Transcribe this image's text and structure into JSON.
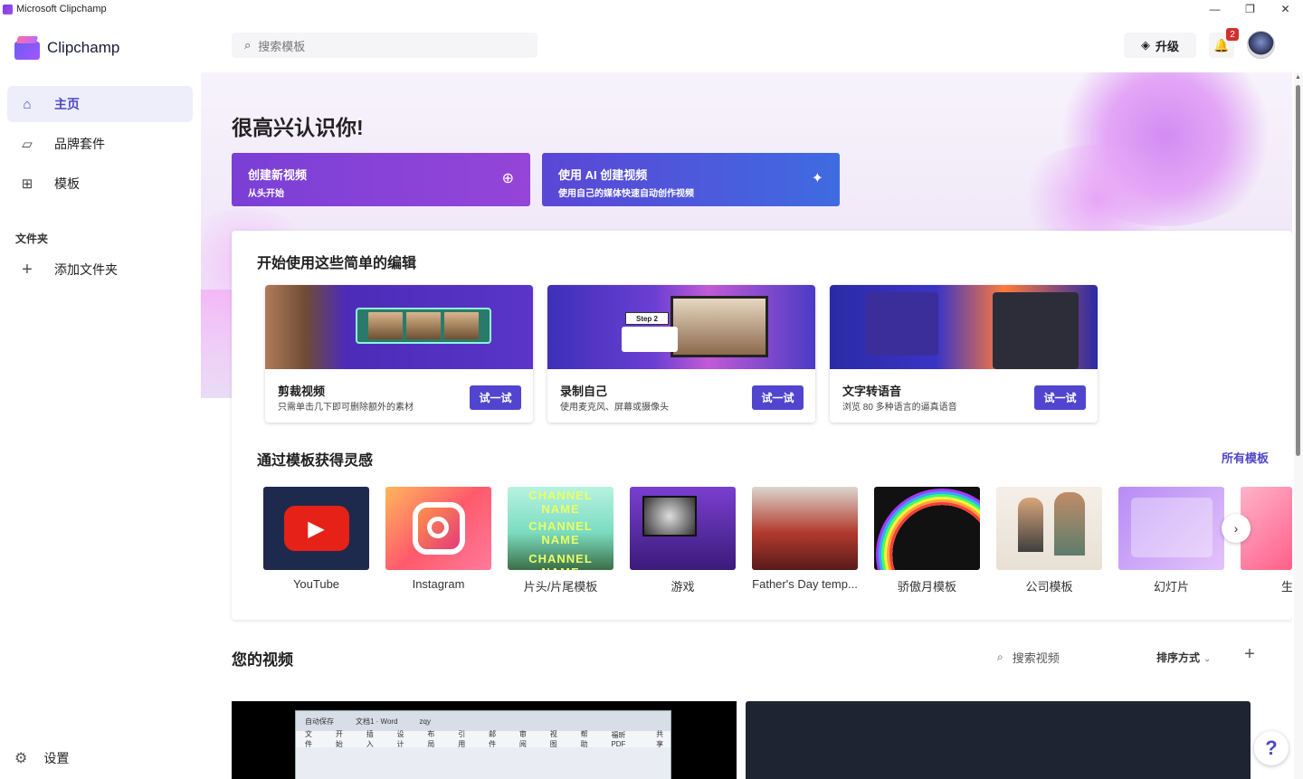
{
  "window": {
    "title": "Microsoft Clipchamp",
    "controls": {
      "minimize": "—",
      "maximize": "❐",
      "close": "✕"
    }
  },
  "sidebar": {
    "brand": "Clipchamp",
    "items": [
      {
        "label": "主页",
        "icon": "home-icon",
        "glyph": "⌂",
        "active": true
      },
      {
        "label": "品牌套件",
        "icon": "brand-kit-icon",
        "glyph": "▱",
        "active": false
      },
      {
        "label": "模板",
        "icon": "templates-icon",
        "glyph": "⊞",
        "active": false
      }
    ],
    "section_label": "文件夹",
    "add_folder": {
      "label": "添加文件夹",
      "glyph": "+"
    },
    "settings": {
      "label": "设置",
      "glyph": "⚙"
    }
  },
  "topbar": {
    "search_placeholder": "搜索模板",
    "search_glyph": "⌕",
    "upgrade_label": "升级",
    "upgrade_glyph": "◈",
    "bell_glyph": "🔔",
    "notification_count": "2"
  },
  "hero": {
    "greeting": "很高兴认识你!",
    "create": {
      "title": "创建新视频",
      "subtitle": "从头开始",
      "glyph": "⊕"
    },
    "ai": {
      "title": "使用 AI 创建视频",
      "subtitle": "使用自己的媒体快速自动创作视频",
      "glyph": "✦"
    }
  },
  "quick_edits": {
    "heading": "开始使用这些简单的编辑",
    "cards": [
      {
        "title": "剪裁视频",
        "subtitle": "只需单击几下即可删除额外的素材",
        "button": "试一试"
      },
      {
        "title": "录制自己",
        "subtitle": "使用麦克风、屏幕或摄像头",
        "button": "试一试",
        "badge": "Step 2"
      },
      {
        "title": "文字转语音",
        "subtitle": "浏览 80 多种语言的逼真语音",
        "button": "试一试"
      }
    ]
  },
  "templates": {
    "heading": "通过模板获得灵感",
    "all_link": "所有模板",
    "items": [
      {
        "name": "YouTube"
      },
      {
        "name": "Instagram"
      },
      {
        "name": "片头/片尾模板",
        "thumb_text": "CHANNEL NAME"
      },
      {
        "name": "游戏"
      },
      {
        "name": "Father's Day temp..."
      },
      {
        "name": "骄傲月模板"
      },
      {
        "name": "公司模板"
      },
      {
        "name": "幻灯片"
      },
      {
        "name": "生"
      }
    ],
    "next_glyph": "›"
  },
  "videos": {
    "heading": "您的视频",
    "search_placeholder": "搜索视频",
    "search_glyph": "⌕",
    "sort_label": "排序方式",
    "sort_glyph": "⌄",
    "add_glyph": "+",
    "word_preview": {
      "titlebar": [
        "自动保存",
        "文档1 · Word",
        "zqy"
      ],
      "menu": [
        "文件",
        "开始",
        "插入",
        "设计",
        "布局",
        "引用",
        "邮件",
        "审阅",
        "视图",
        "帮助",
        "福昕PDF",
        "共享"
      ]
    }
  },
  "help_glyph": "?",
  "colors": {
    "accent": "#4f46c9",
    "create": "#8541d7",
    "ai": "#4d5adb"
  }
}
